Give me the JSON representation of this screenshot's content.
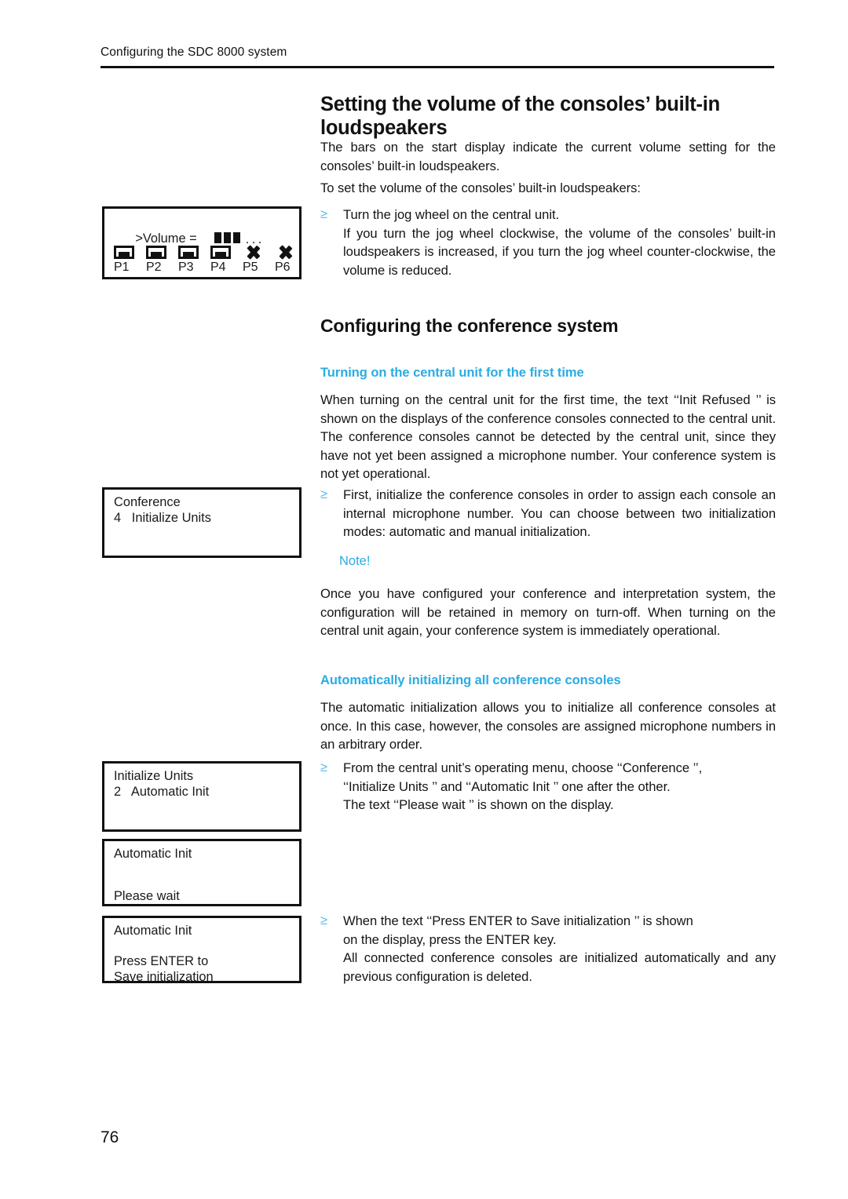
{
  "header": {
    "running_title": "Configuring the SDC 8000 system"
  },
  "folio": {
    "page_number": "76"
  },
  "sections": {
    "volume": {
      "title": "Setting the volume of the consoles’ built-in loudspeakers",
      "p1": "The bars on the start display indicate the current volume setting for the consoles’ built-in loudspeakers.",
      "p2": "To set the volume of the consoles’ built-in loudspeakers:",
      "bullet_marker": "≥",
      "b1_line1": "Turn the jog wheel        on the central unit.",
      "b1_line2": "If you turn the jog wheel clockwise, the volume of the consoles’ built-in loudspeakers is increased, if you turn the jog wheel counter-clockwise, the volume is reduced."
    },
    "configuring": {
      "title": "Configuring the conference system",
      "sub1_title": "Turning on the central unit for the first time",
      "sub1_p1": "When turning on the central unit for the first time, the text ‘‘Init Refused  ’’ is shown on the displays of the conference consoles connected to the central unit. The conference consoles cannot be detected by the central unit, since they have not yet been assigned a microphone number. Your conference system is not yet operational.",
      "sub1_b1": "First, initialize the conference consoles in order to assign each console an internal microphone number. You can choose between two initialization modes: automatic and manual initialization.",
      "note_label": "Note!",
      "note_body": "Once you have configured your conference and interpretation system, the configuration will be retained in memory on turn-off. When turning on the central unit again, your conference system is immediately operational.",
      "sub2_title": "Automatically initializing all conference consoles",
      "sub2_p1": "The automatic initialization allows you to initialize all conference consoles at once. In this case, however, the consoles are assigned microphone numbers in an arbitrary order.",
      "sub2_b1_line1": "From the central unit’s operating menu, choose ‘‘Conference   ’’,",
      "sub2_b1_line2": "‘‘Initialize Units            ’’ and ‘‘Automatic Init        ’’ one after the other.",
      "sub2_b1_line3": "The text ‘‘Please wait      ’’ is shown on the display.",
      "sub2_b2_line1": "When the text ‘‘Press ENTER to Save initialization                ’’ is shown",
      "sub2_b2_line2": "on the display, press the ENTER key.",
      "sub2_b2_line3": "All connected conference consoles are initialized automatically and any previous configuration is deleted."
    }
  },
  "lcd_displays": [
    {
      "id": "volume-display",
      "line1": ">Volume =",
      "bars_filled": 3,
      "bars_empty_dots": "...",
      "channel_labels": [
        "P1",
        "P2",
        "P3",
        "P4",
        "P5",
        "P6"
      ],
      "channel_icons": [
        "speaker",
        "speaker",
        "speaker",
        "speaker",
        "muted",
        "muted"
      ]
    },
    {
      "id": "conference-menu-display",
      "line1": "Conference",
      "line2_index": "4",
      "line2_text": "Initialize Units"
    },
    {
      "id": "initialize-units-display",
      "line1": "Initialize Units",
      "line2_index": "2",
      "line2_text": "Automatic Init"
    },
    {
      "id": "please-wait-display",
      "line1": "Automatic Init",
      "line2": "Please wait"
    },
    {
      "id": "press-enter-display",
      "line1": "Automatic Init",
      "line2": "Press ENTER to",
      "line3": "Save initialization"
    }
  ],
  "colors": {
    "accent_cyan": "#29ACE3",
    "bullet_marker": "#56BDEA",
    "text": "#141414",
    "rule": "#111111"
  }
}
